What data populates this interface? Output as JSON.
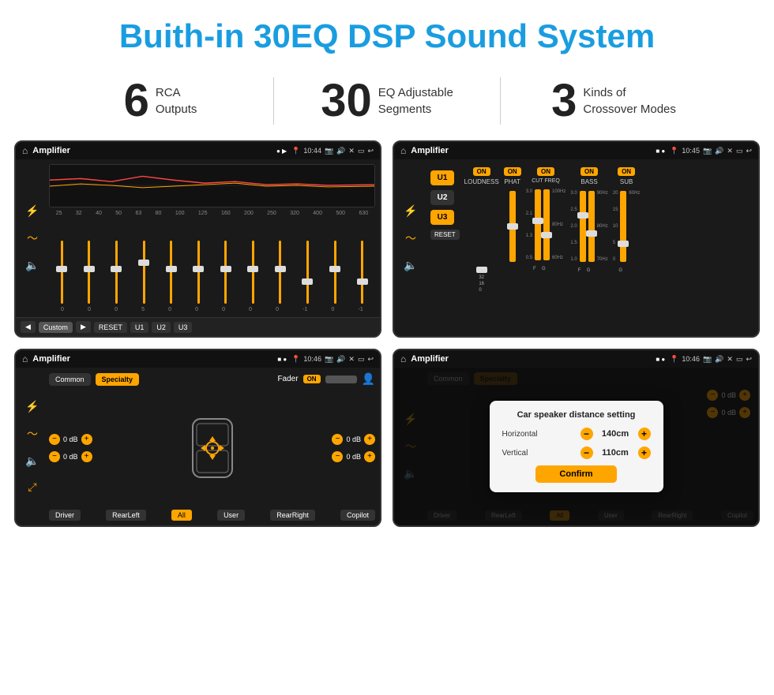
{
  "page": {
    "title": "Buith-in 30EQ DSP Sound System"
  },
  "stats": [
    {
      "number": "6",
      "text_line1": "RCA",
      "text_line2": "Outputs"
    },
    {
      "number": "30",
      "text_line1": "EQ Adjustable",
      "text_line2": "Segments"
    },
    {
      "number": "3",
      "text_line1": "Kinds of",
      "text_line2": "Crossover Modes"
    }
  ],
  "screens": {
    "eq": {
      "app_name": "Amplifier",
      "time": "10:44",
      "freq_labels": [
        "25",
        "32",
        "40",
        "50",
        "63",
        "80",
        "100",
        "125",
        "160",
        "200",
        "250",
        "320",
        "400",
        "500",
        "630"
      ],
      "values": [
        "0",
        "0",
        "0",
        "5",
        "0",
        "0",
        "0",
        "0",
        "0",
        "-1",
        "0",
        "-1"
      ],
      "preset": "Custom",
      "buttons": [
        "RESET",
        "U1",
        "U2",
        "U3"
      ]
    },
    "crossover": {
      "app_name": "Amplifier",
      "time": "10:45",
      "u_buttons": [
        "U1",
        "U2",
        "U3"
      ],
      "controls": [
        {
          "label": "LOUDNESS",
          "on": true
        },
        {
          "label": "PHAT",
          "on": true
        },
        {
          "label": "CUT FREQ",
          "on": true
        },
        {
          "label": "BASS",
          "on": true
        },
        {
          "label": "SUB",
          "on": true
        }
      ],
      "reset_label": "RESET"
    },
    "fader": {
      "app_name": "Amplifier",
      "time": "10:46",
      "tabs": [
        "Common",
        "Specialty"
      ],
      "fader_label": "Fader",
      "on_label": "ON",
      "speaker_controls": {
        "top_left": "0 dB",
        "bottom_left": "0 dB",
        "top_right": "0 dB",
        "bottom_right": "0 dB"
      },
      "bottom_buttons": [
        "Driver",
        "RearLeft",
        "All",
        "User",
        "RearRight",
        "Copilot"
      ]
    },
    "dialog": {
      "app_name": "Amplifier",
      "time": "10:46",
      "dialog_title": "Car speaker distance setting",
      "horizontal_label": "Horizontal",
      "horizontal_value": "140cm",
      "vertical_label": "Vertical",
      "vertical_value": "110cm",
      "confirm_label": "Confirm",
      "bottom_buttons": [
        "Driver",
        "RearLeft",
        "All",
        "User",
        "RearRight",
        "Copilot"
      ]
    }
  }
}
